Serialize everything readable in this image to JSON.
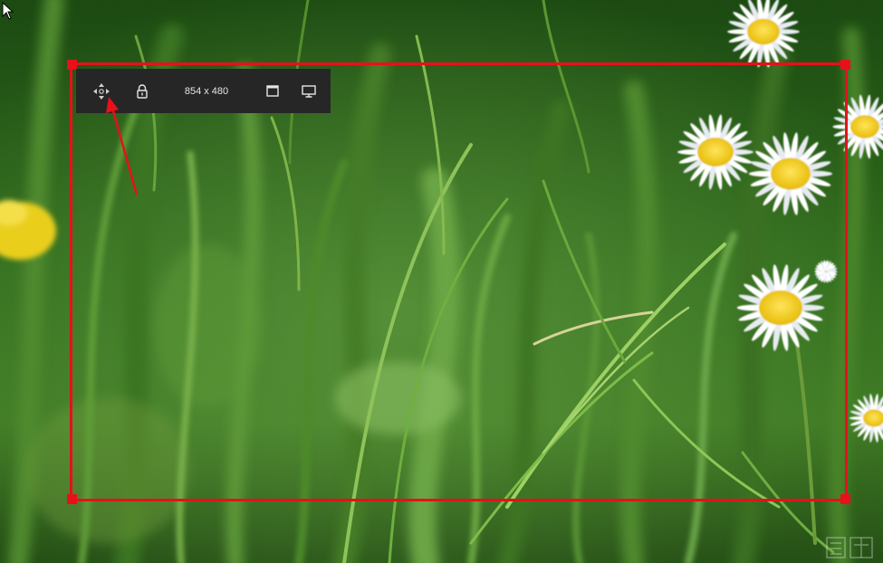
{
  "toolbar": {
    "dimensions": "854 x 480",
    "icons": {
      "move": "move-arrows-icon",
      "lock": "lock-icon",
      "window": "window-icon",
      "screen": "monitor-icon"
    }
  },
  "colors": {
    "selection_border": "#e8101a",
    "toolbar_bg": "#262626",
    "toolbar_text": "#e6e6e6",
    "annotation_arrow": "#e8101a"
  }
}
